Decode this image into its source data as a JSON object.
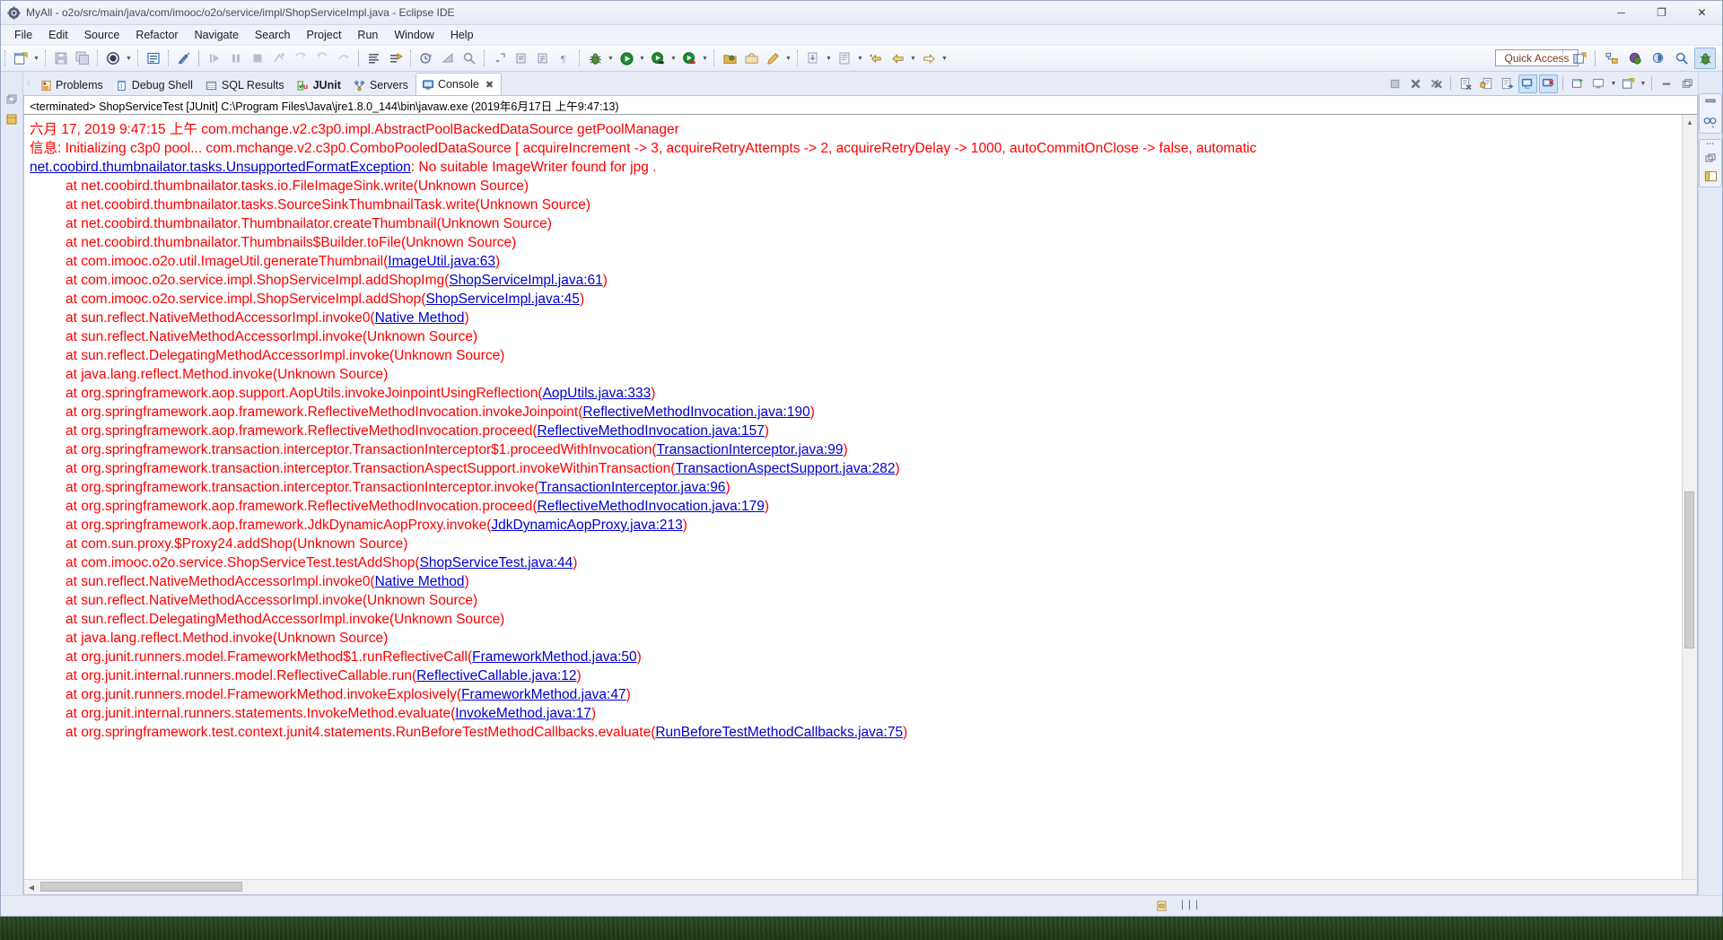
{
  "window": {
    "title": "MyAll - o2o/src/main/java/com/imooc/o2o/service/impl/ShopServiceImpl.java - Eclipse IDE",
    "app_icon": "eclipse-icon",
    "minimize": "─",
    "maximize": "❐",
    "close": "✕"
  },
  "menubar": {
    "items": [
      {
        "label": "File"
      },
      {
        "label": "Edit"
      },
      {
        "label": "Source"
      },
      {
        "label": "Refactor"
      },
      {
        "label": "Navigate"
      },
      {
        "label": "Search"
      },
      {
        "label": "Project"
      },
      {
        "label": "Run"
      },
      {
        "label": "Window"
      },
      {
        "label": "Help"
      }
    ]
  },
  "toolbar": {
    "quick_access_placeholder": "Quick Access",
    "buttons": [
      {
        "name": "new-wizard-icon"
      },
      {
        "name": "new-wizard-dropdown-icon"
      },
      {
        "name": "save-icon"
      },
      {
        "name": "save-all-icon"
      },
      {
        "name": "new-java-class-icon"
      },
      {
        "name": "new-java-class-dropdown-icon"
      },
      {
        "name": "open-type-icon"
      },
      {
        "name": "toggle-mark-occurrences-icon"
      },
      {
        "name": "resume-icon"
      },
      {
        "name": "suspend-icon"
      },
      {
        "name": "terminate-icon"
      },
      {
        "name": "disconnect-icon"
      },
      {
        "name": "step-into-icon"
      },
      {
        "name": "step-over-icon"
      },
      {
        "name": "step-return-icon"
      },
      {
        "name": "skip-breakpoints-icon"
      },
      {
        "name": "toggle-step-filters-icon"
      },
      {
        "name": "open-perspective-history-icon"
      },
      {
        "name": "build-all-icon"
      },
      {
        "name": "search-icon"
      },
      {
        "name": "next-annotation-icon"
      },
      {
        "name": "previous-annotation-icon"
      },
      {
        "name": "last-edit-location-icon"
      },
      {
        "name": "debug-icon"
      },
      {
        "name": "debug-dropdown-icon"
      },
      {
        "name": "run-icon"
      },
      {
        "name": "run-dropdown-icon"
      },
      {
        "name": "coverage-icon"
      },
      {
        "name": "coverage-dropdown-icon"
      },
      {
        "name": "external-tools-icon"
      },
      {
        "name": "new-package-icon"
      },
      {
        "name": "new-annotation-icon"
      },
      {
        "name": "pencil-icon"
      },
      {
        "name": "pencil-dropdown-icon"
      },
      {
        "name": "download-icon"
      },
      {
        "name": "download-dropdown-icon"
      },
      {
        "name": "snippet-icon"
      },
      {
        "name": "snippet-dropdown-icon"
      },
      {
        "name": "back-star-icon"
      },
      {
        "name": "back-icon"
      },
      {
        "name": "back-dropdown-icon"
      },
      {
        "name": "forward-icon"
      },
      {
        "name": "forward-dropdown-icon"
      }
    ],
    "perspective_buttons": [
      {
        "name": "open-perspective-icon"
      },
      {
        "name": "perspective-team-sync-icon"
      },
      {
        "name": "perspective-java-ee-icon"
      },
      {
        "name": "perspective-java-icon"
      },
      {
        "name": "perspective-java-browsing-icon"
      },
      {
        "name": "perspective-debug-icon",
        "active": true
      }
    ]
  },
  "view_tabs": [
    {
      "label": "Problems",
      "icon": "problems-icon",
      "active": false,
      "bold": false
    },
    {
      "label": "Debug Shell",
      "icon": "debug-shell-icon",
      "active": false,
      "bold": false
    },
    {
      "label": "SQL Results",
      "icon": "sql-results-icon",
      "active": false,
      "bold": false
    },
    {
      "label": "JUnit",
      "icon": "junit-icon",
      "active": false,
      "bold": true
    },
    {
      "label": "Servers",
      "icon": "servers-icon",
      "active": false,
      "bold": false
    },
    {
      "label": "Console",
      "icon": "console-icon",
      "active": true,
      "bold": false,
      "close": "✖"
    }
  ],
  "console_toolbar": [
    {
      "name": "terminate-console-icon",
      "toggled": false
    },
    {
      "name": "remove-launch-icon",
      "toggled": false
    },
    {
      "name": "remove-all-terminated-icon",
      "toggled": false
    },
    {
      "name": "clear-console-icon",
      "toggled": false
    },
    {
      "name": "scroll-lock-icon",
      "toggled": false
    },
    {
      "name": "word-wrap-icon",
      "toggled": false
    },
    {
      "name": "show-console-on-output-icon",
      "toggled": true
    },
    {
      "name": "show-console-on-error-icon",
      "toggled": true
    },
    {
      "name": "pin-console-icon",
      "toggled": false
    },
    {
      "name": "display-selected-console-icon",
      "toggled": false
    },
    {
      "name": "display-selected-console-dropdown-icon",
      "toggled": false
    },
    {
      "name": "open-console-icon",
      "toggled": false
    },
    {
      "name": "open-console-dropdown-icon",
      "toggled": false
    },
    {
      "name": "minimize-view-icon",
      "toggled": false
    },
    {
      "name": "maximize-view-icon",
      "toggled": false
    }
  ],
  "console": {
    "header": "<terminated> ShopServiceTest [JUnit] C:\\Program Files\\Java\\jre1.8.0_144\\bin\\javaw.exe (2019年6月17日 上午9:47:13)",
    "lines": [
      {
        "indent": false,
        "segments": [
          {
            "text": "六月 17, 2019 9:47:15 上午 com.mchange.v2.c3p0.impl.AbstractPoolBackedDataSource getPoolManager",
            "link": false
          }
        ]
      },
      {
        "indent": false,
        "segments": [
          {
            "text": "信息: Initializing c3p0 pool... com.mchange.v2.c3p0.ComboPooledDataSource [ acquireIncrement -> 3, acquireRetryAttempts -> 2, acquireRetryDelay -> 1000, autoCommitOnClose -> false, automatic",
            "link": false
          }
        ]
      },
      {
        "indent": false,
        "segments": [
          {
            "text": "net.coobird.thumbnailator.tasks.UnsupportedFormatException",
            "link": true
          },
          {
            "text": ": No suitable ImageWriter found for jpg .",
            "link": false
          }
        ]
      },
      {
        "indent": true,
        "segments": [
          {
            "text": "at net.coobird.thumbnailator.tasks.io.FileImageSink.write(Unknown Source)",
            "link": false
          }
        ]
      },
      {
        "indent": true,
        "segments": [
          {
            "text": "at net.coobird.thumbnailator.tasks.SourceSinkThumbnailTask.write(Unknown Source)",
            "link": false
          }
        ]
      },
      {
        "indent": true,
        "segments": [
          {
            "text": "at net.coobird.thumbnailator.Thumbnailator.createThumbnail(Unknown Source)",
            "link": false
          }
        ]
      },
      {
        "indent": true,
        "segments": [
          {
            "text": "at net.coobird.thumbnailator.Thumbnails$Builder.toFile(Unknown Source)",
            "link": false
          }
        ]
      },
      {
        "indent": true,
        "segments": [
          {
            "text": "at com.imooc.o2o.util.ImageUtil.generateThumbnail(",
            "link": false
          },
          {
            "text": "ImageUtil.java:63",
            "link": true
          },
          {
            "text": ")",
            "link": false
          }
        ]
      },
      {
        "indent": true,
        "segments": [
          {
            "text": "at com.imooc.o2o.service.impl.ShopServiceImpl.addShopImg(",
            "link": false
          },
          {
            "text": "ShopServiceImpl.java:61",
            "link": true
          },
          {
            "text": ")",
            "link": false
          }
        ]
      },
      {
        "indent": true,
        "segments": [
          {
            "text": "at com.imooc.o2o.service.impl.ShopServiceImpl.addShop(",
            "link": false
          },
          {
            "text": "ShopServiceImpl.java:45",
            "link": true
          },
          {
            "text": ")",
            "link": false
          }
        ]
      },
      {
        "indent": true,
        "segments": [
          {
            "text": "at sun.reflect.NativeMethodAccessorImpl.invoke0(",
            "link": false
          },
          {
            "text": "Native Method",
            "link": true
          },
          {
            "text": ")",
            "link": false
          }
        ]
      },
      {
        "indent": true,
        "segments": [
          {
            "text": "at sun.reflect.NativeMethodAccessorImpl.invoke(Unknown Source)",
            "link": false
          }
        ]
      },
      {
        "indent": true,
        "segments": [
          {
            "text": "at sun.reflect.DelegatingMethodAccessorImpl.invoke(Unknown Source)",
            "link": false
          }
        ]
      },
      {
        "indent": true,
        "segments": [
          {
            "text": "at java.lang.reflect.Method.invoke(Unknown Source)",
            "link": false
          }
        ]
      },
      {
        "indent": true,
        "segments": [
          {
            "text": "at org.springframework.aop.support.AopUtils.invokeJoinpointUsingReflection(",
            "link": false
          },
          {
            "text": "AopUtils.java:333",
            "link": true
          },
          {
            "text": ")",
            "link": false
          }
        ]
      },
      {
        "indent": true,
        "segments": [
          {
            "text": "at org.springframework.aop.framework.ReflectiveMethodInvocation.invokeJoinpoint(",
            "link": false
          },
          {
            "text": "ReflectiveMethodInvocation.java:190",
            "link": true
          },
          {
            "text": ")",
            "link": false
          }
        ]
      },
      {
        "indent": true,
        "segments": [
          {
            "text": "at org.springframework.aop.framework.ReflectiveMethodInvocation.proceed(",
            "link": false
          },
          {
            "text": "ReflectiveMethodInvocation.java:157",
            "link": true
          },
          {
            "text": ")",
            "link": false
          }
        ]
      },
      {
        "indent": true,
        "segments": [
          {
            "text": "at org.springframework.transaction.interceptor.TransactionInterceptor$1.proceedWithInvocation(",
            "link": false
          },
          {
            "text": "TransactionInterceptor.java:99",
            "link": true
          },
          {
            "text": ")",
            "link": false
          }
        ]
      },
      {
        "indent": true,
        "segments": [
          {
            "text": "at org.springframework.transaction.interceptor.TransactionAspectSupport.invokeWithinTransaction(",
            "link": false
          },
          {
            "text": "TransactionAspectSupport.java:282",
            "link": true
          },
          {
            "text": ")",
            "link": false
          }
        ]
      },
      {
        "indent": true,
        "segments": [
          {
            "text": "at org.springframework.transaction.interceptor.TransactionInterceptor.invoke(",
            "link": false
          },
          {
            "text": "TransactionInterceptor.java:96",
            "link": true
          },
          {
            "text": ")",
            "link": false
          }
        ]
      },
      {
        "indent": true,
        "segments": [
          {
            "text": "at org.springframework.aop.framework.ReflectiveMethodInvocation.proceed(",
            "link": false
          },
          {
            "text": "ReflectiveMethodInvocation.java:179",
            "link": true
          },
          {
            "text": ")",
            "link": false
          }
        ]
      },
      {
        "indent": true,
        "segments": [
          {
            "text": "at org.springframework.aop.framework.JdkDynamicAopProxy.invoke(",
            "link": false
          },
          {
            "text": "JdkDynamicAopProxy.java:213",
            "link": true
          },
          {
            "text": ")",
            "link": false
          }
        ]
      },
      {
        "indent": true,
        "segments": [
          {
            "text": "at com.sun.proxy.$Proxy24.addShop(Unknown Source)",
            "link": false
          }
        ]
      },
      {
        "indent": true,
        "segments": [
          {
            "text": "at com.imooc.o2o.service.ShopServiceTest.testAddShop(",
            "link": false
          },
          {
            "text": "ShopServiceTest.java:44",
            "link": true
          },
          {
            "text": ")",
            "link": false
          }
        ]
      },
      {
        "indent": true,
        "segments": [
          {
            "text": "at sun.reflect.NativeMethodAccessorImpl.invoke0(",
            "link": false
          },
          {
            "text": "Native Method",
            "link": true
          },
          {
            "text": ")",
            "link": false
          }
        ]
      },
      {
        "indent": true,
        "segments": [
          {
            "text": "at sun.reflect.NativeMethodAccessorImpl.invoke(Unknown Source)",
            "link": false
          }
        ]
      },
      {
        "indent": true,
        "segments": [
          {
            "text": "at sun.reflect.DelegatingMethodAccessorImpl.invoke(Unknown Source)",
            "link": false
          }
        ]
      },
      {
        "indent": true,
        "segments": [
          {
            "text": "at java.lang.reflect.Method.invoke(Unknown Source)",
            "link": false
          }
        ]
      },
      {
        "indent": true,
        "segments": [
          {
            "text": "at org.junit.runners.model.FrameworkMethod$1.runReflectiveCall(",
            "link": false
          },
          {
            "text": "FrameworkMethod.java:50",
            "link": true
          },
          {
            "text": ")",
            "link": false
          }
        ]
      },
      {
        "indent": true,
        "segments": [
          {
            "text": "at org.junit.internal.runners.model.ReflectiveCallable.run(",
            "link": false
          },
          {
            "text": "ReflectiveCallable.java:12",
            "link": true
          },
          {
            "text": ")",
            "link": false
          }
        ]
      },
      {
        "indent": true,
        "segments": [
          {
            "text": "at org.junit.runners.model.FrameworkMethod.invokeExplosively(",
            "link": false
          },
          {
            "text": "FrameworkMethod.java:47",
            "link": true
          },
          {
            "text": ")",
            "link": false
          }
        ]
      },
      {
        "indent": true,
        "segments": [
          {
            "text": "at org.junit.internal.runners.statements.InvokeMethod.evaluate(",
            "link": false
          },
          {
            "text": "InvokeMethod.java:17",
            "link": true
          },
          {
            "text": ")",
            "link": false
          }
        ]
      },
      {
        "indent": true,
        "segments": [
          {
            "text": "at org.springframework.test.context.junit4.statements.RunBeforeTestMethodCallbacks.evaluate(",
            "link": false
          },
          {
            "text": "RunBeforeTestMethodCallbacks.java:75",
            "link": true
          },
          {
            "text": ")",
            "link": false
          }
        ]
      }
    ]
  },
  "colors": {
    "error_text": "#ff0000",
    "hyperlink": "#0000d0",
    "chrome": "#e8ecf7",
    "tab_active_bg": "#ffffff"
  },
  "status_bar": {
    "icon": "writable-indicator-icon",
    "bars": "▕▕▕"
  }
}
